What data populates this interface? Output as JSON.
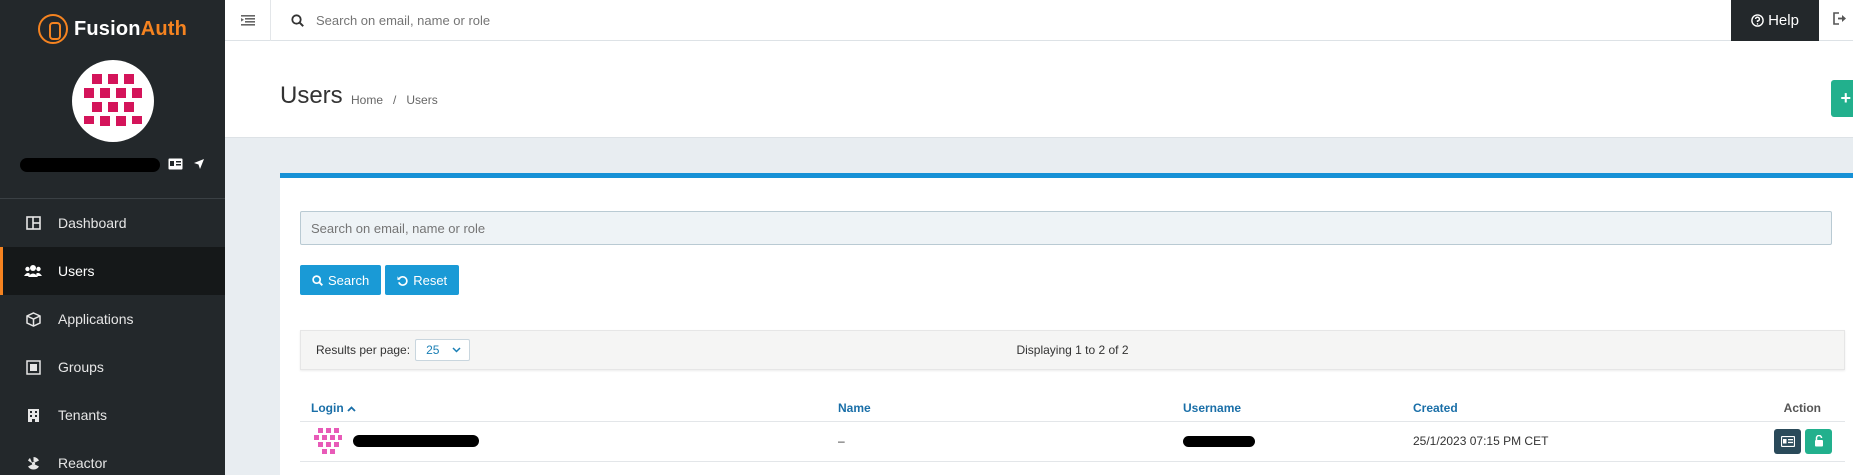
{
  "brand": {
    "name_part1": "Fusion",
    "name_part2": "Auth"
  },
  "sidebar": {
    "items": [
      {
        "label": "Dashboard",
        "icon": "dashboard-icon"
      },
      {
        "label": "Users",
        "icon": "users-icon",
        "active": true
      },
      {
        "label": "Applications",
        "icon": "cube-icon"
      },
      {
        "label": "Groups",
        "icon": "groups-icon"
      },
      {
        "label": "Tenants",
        "icon": "tenants-icon"
      },
      {
        "label": "Reactor",
        "icon": "reactor-icon"
      }
    ]
  },
  "topbar": {
    "search_placeholder": "Search on email, name or role",
    "help_label": "Help"
  },
  "header": {
    "title": "Users",
    "breadcrumb": {
      "home": "Home",
      "separator": "/",
      "current": "Users"
    }
  },
  "panel": {
    "search_placeholder": "Search on email, name or role",
    "search_button": "Search",
    "reset_button": "Reset",
    "results_per_page_label": "Results per page:",
    "results_per_page_value": "25",
    "displaying": "Displaying 1 to 2 of 2"
  },
  "table": {
    "columns": {
      "login": "Login",
      "name": "Name",
      "username": "Username",
      "created": "Created",
      "action": "Action"
    },
    "rows": [
      {
        "name": "–",
        "created": "25/1/2023 07:15 PM CET"
      }
    ]
  },
  "colors": {
    "sidebar_bg": "#23282b",
    "accent_orange": "#f58320",
    "primary_blue": "#1a9ad6",
    "success_green": "#22b08d",
    "avatar_pink": "#d4145a"
  }
}
